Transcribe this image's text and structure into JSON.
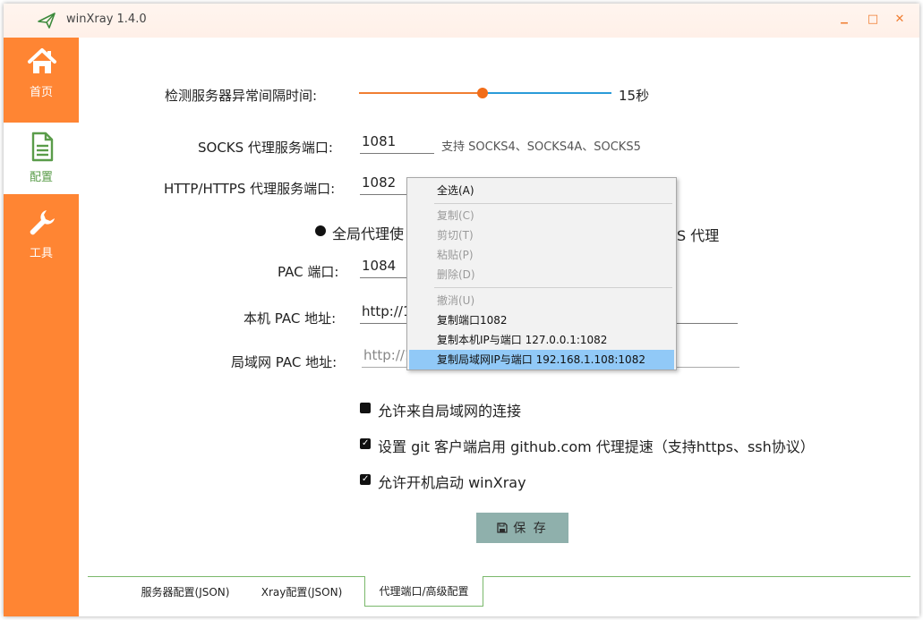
{
  "window": {
    "title": "winXray 1.4.0",
    "accent_color": "#ff8533",
    "controls": {
      "minimize": "▁",
      "maximize": "□",
      "close": "✕"
    }
  },
  "sidebar": {
    "items": [
      {
        "label": "首页",
        "icon": "home-icon",
        "active": false
      },
      {
        "label": "配置",
        "icon": "document-icon",
        "active": true
      },
      {
        "label": "工具",
        "icon": "wrench-icon",
        "active": false
      }
    ]
  },
  "settings": {
    "interval_label": "检测服务器异常间隔时间:",
    "interval_value": "15秒",
    "interval_fraction": 0.49,
    "socks_label": "SOCKS 代理服务端口:",
    "socks_port": "1081",
    "socks_hint": "支持 SOCKS4、SOCKS4A、SOCKS5",
    "http_label": "HTTP/HTTPS 代理服务端口:",
    "http_port": "1082",
    "radio_global_text": "全局代理使",
    "radio_tail_text": "S 代理",
    "pac_label": "PAC 端口:",
    "pac_port": "1084",
    "local_pac_label": "本机 PAC 地址:",
    "local_pac_value": "http://1",
    "lan_pac_label": "局域网 PAC 地址:",
    "lan_pac_value": "http://1",
    "allow_lan_text": "允许来自局域网的连接",
    "allow_lan_checked": false,
    "git_proxy_text": "设置 git 客户端启用 github.com 代理提速（支持https、ssh协议）",
    "git_proxy_checked": true,
    "autostart_text": "允许开机启动 winXray",
    "autostart_checked": true,
    "save_label": "保 存"
  },
  "tabs": [
    {
      "label": "服务器配置(JSON)",
      "active": false
    },
    {
      "label": "Xray配置(JSON)",
      "active": false
    },
    {
      "label": "代理端口/高级配置",
      "active": true
    }
  ],
  "context_menu": {
    "items": [
      {
        "label": "全选(A)",
        "disabled": false
      },
      {
        "label": "复制(C)",
        "disabled": true
      },
      {
        "label": "剪切(T)",
        "disabled": true
      },
      {
        "label": "粘贴(P)",
        "disabled": true
      },
      {
        "label": "删除(D)",
        "disabled": true
      },
      {
        "label": "撤消(U)",
        "disabled": true
      },
      {
        "label": "复制端口1082",
        "disabled": false
      },
      {
        "label": "复制本机IP与端口 127.0.0.1:1082",
        "disabled": false
      },
      {
        "label": "复制局域网IP与端口 192.168.1.108:1082",
        "disabled": false,
        "highlighted": true
      }
    ]
  }
}
